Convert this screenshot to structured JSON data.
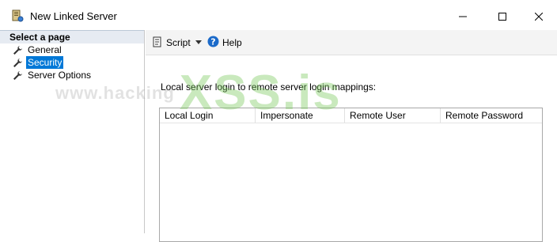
{
  "window": {
    "title": "New Linked Server"
  },
  "sidebar": {
    "header": "Select a page",
    "items": [
      {
        "label": "General",
        "icon": "wrench-icon"
      },
      {
        "label": "Security",
        "icon": "wrench-icon",
        "selected": true
      },
      {
        "label": "Server Options",
        "icon": "wrench-icon"
      }
    ]
  },
  "toolbar": {
    "script_label": "Script",
    "help_label": "Help"
  },
  "content": {
    "mapping_label": "Local server login to remote server login mappings:",
    "columns": [
      "Local Login",
      "Impersonate",
      "Remote User",
      "Remote Password"
    ],
    "rows": []
  },
  "watermark": {
    "url": "www.hacking",
    "brand": "XSS.is"
  },
  "colors": {
    "selection": "#0078d7",
    "sidebar_header_bg": "#e6ebf2",
    "toolbar_bg": "#f4f4f4",
    "help_icon": "#1b6ac9"
  }
}
